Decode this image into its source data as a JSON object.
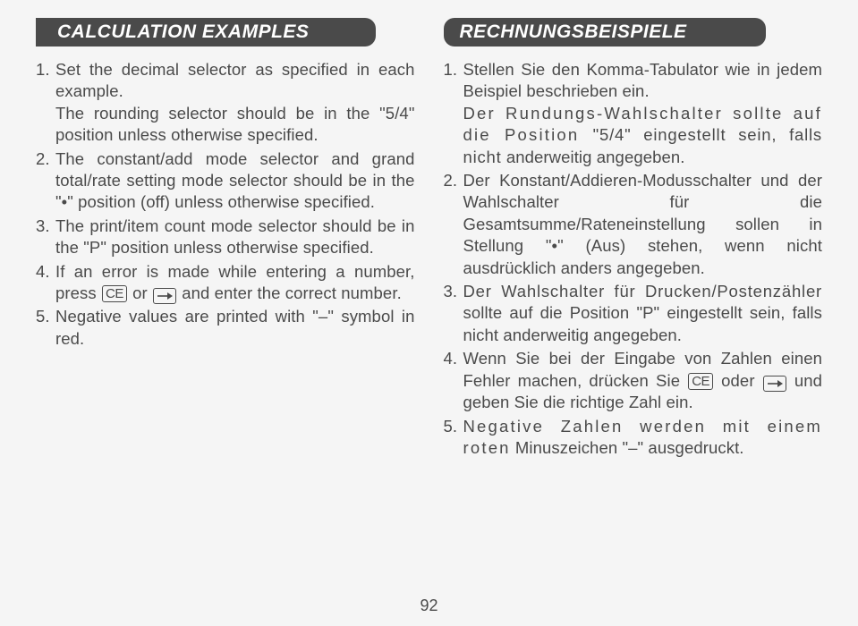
{
  "page_number": "92",
  "left": {
    "heading": "CALCULATION EXAMPLES",
    "items": [
      {
        "text": "Set the decimal selector as specified in each example.",
        "sub": "The rounding selector should be in the \"5/4\" position unless otherwise specified."
      },
      {
        "text": "The constant/add mode selector and grand total/rate setting mode selector should be in the \"•\" position (off) unless otherwise specified."
      },
      {
        "text": "The print/item count mode selector should be in the \"P\" position unless otherwise specified."
      },
      {
        "pre": "If an error is made while entering a number, press ",
        "key1": "CE",
        "mid": " or ",
        "post": " and enter the correct number."
      },
      {
        "text": "Negative values are printed with \"–\" symbol in red."
      }
    ]
  },
  "right": {
    "heading": "RECHNUNGSBEISPIELE",
    "items": [
      {
        "text": "Stellen Sie den Komma-Tabulator wie in jedem Beispiel beschrieben ein.",
        "sub_pre": "Der Rundungs-Wahlschalter sollte auf die Position ",
        "sub_mid": "\"5/4\" eingestellt sein, falls nicht",
        "sub_post": " anderweitig angegeben."
      },
      {
        "text": "Der Konstant/Addieren-Modusschalter und der Wahlschalter für die Gesamtsumme/Rateneinstellung sollen in Stellung \"•\" (Aus) stehen, wenn nicht ausdrücklich anders angegeben."
      },
      {
        "pre": "Der Wahlschalter für Drucken/Postenzähler",
        "post": " sollte auf die Position \"P\" eingestellt sein, falls nicht anderweitig angegeben."
      },
      {
        "pre": "Wenn Sie bei der Eingabe von Zahlen einen Fehler machen, drücken Sie ",
        "key1": "CE",
        "mid": " oder ",
        "post": " und geben Sie die richtige Zahl ein."
      },
      {
        "pre": "Negative Zahlen werden mit einem roten",
        "post": " Minuszeichen \"–\" ausgedruckt."
      }
    ]
  }
}
